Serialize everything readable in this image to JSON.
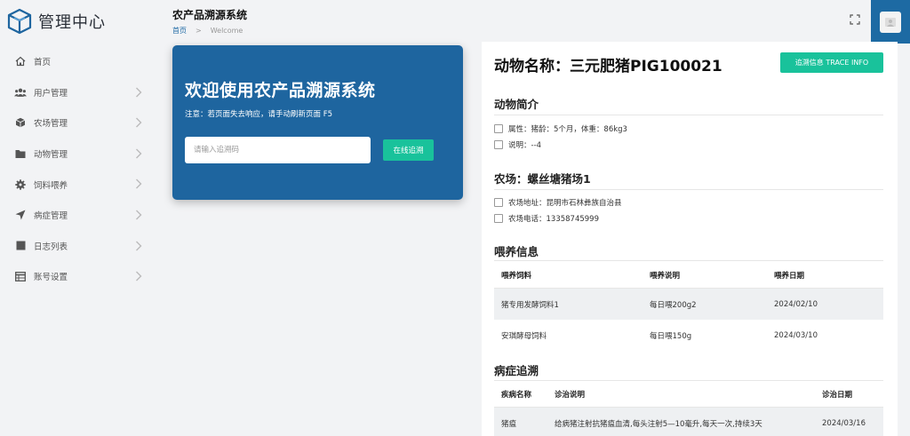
{
  "sidebar": {
    "logo_title": "管理中心",
    "items": [
      {
        "label": "首页",
        "icon": "home-icon",
        "has_arrow": false
      },
      {
        "label": "用户管理",
        "icon": "users-icon",
        "has_arrow": true
      },
      {
        "label": "农场管理",
        "icon": "cube-icon",
        "has_arrow": true
      },
      {
        "label": "动物管理",
        "icon": "folder-icon",
        "has_arrow": true
      },
      {
        "label": "饲料喂养",
        "icon": "gear-icon",
        "has_arrow": true
      },
      {
        "label": "病症管理",
        "icon": "location-arrow-icon",
        "has_arrow": true
      },
      {
        "label": "日志列表",
        "icon": "square-icon",
        "has_arrow": true
      },
      {
        "label": "账号设置",
        "icon": "table-icon",
        "has_arrow": true
      }
    ]
  },
  "header": {
    "title": "农产品溯源系统",
    "breadcrumb": {
      "home": "首页",
      "separator": ">",
      "current": "Welcome"
    }
  },
  "welcome": {
    "title": "欢迎使用农产品溯源系统",
    "note": "注意：若页面失去响应，请手动刷新页面 F5",
    "input_placeholder": "请输入追溯码",
    "button_label": "在线追溯"
  },
  "detail": {
    "animal_title": "动物名称：三元肥猪PIG100021",
    "trace_button": "追溯信息 TRACE INFO",
    "intro": {
      "title": "动物简介",
      "items": [
        "属性：猪龄：5个月，体重：86kg3",
        "说明：--4"
      ]
    },
    "farm": {
      "title": "农场：螺丝塘猪场1",
      "items": [
        "农场地址：昆明市石林彝族自治县",
        "农场电话：13358745999"
      ]
    },
    "feeding": {
      "title": "喂养信息",
      "headers": [
        "喂养饲料",
        "喂养说明",
        "喂养日期"
      ],
      "rows": [
        [
          "猪专用发酵饲料1",
          "每日喂200g2",
          "2024/02/10"
        ],
        [
          "安琪酵母饲料",
          "每日喂150g",
          "2024/03/10"
        ]
      ]
    },
    "disease": {
      "title": "病症追溯",
      "headers": [
        "疾病名称",
        "诊治说明",
        "诊治日期"
      ],
      "rows": [
        [
          "猪瘟",
          "给病猪注射抗猪瘟血清,每头注射5—10毫升,每天一次,持续3天",
          "2024/03/16"
        ]
      ]
    }
  },
  "colors": {
    "brand": "#1e659f",
    "accent": "#19c29b",
    "sidebar_bg": "#f2f3f5"
  }
}
